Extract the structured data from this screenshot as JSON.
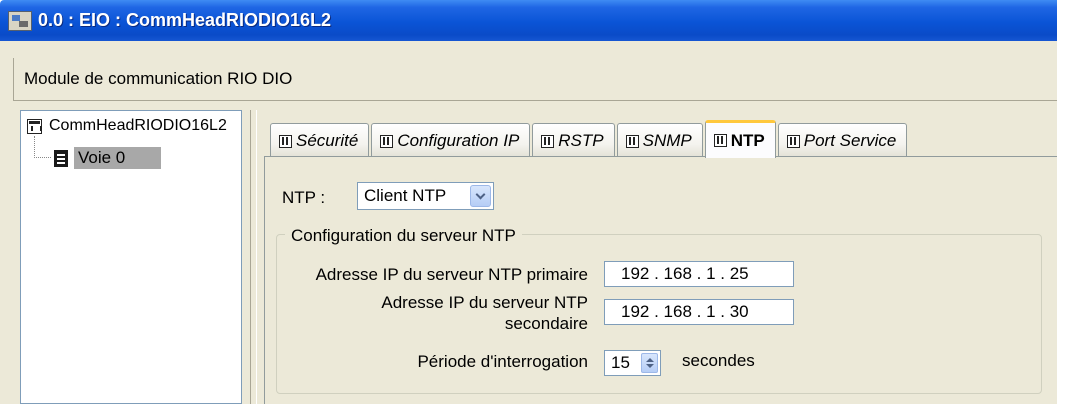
{
  "window": {
    "title": "0.0 : EIO : CommHeadRIODIO16L2",
    "icon": "module-app-icon"
  },
  "header": {
    "title": "Module de communication RIO DIO"
  },
  "tree": {
    "root": {
      "label": "CommHeadRIODIO16L2",
      "icon": "module-icon"
    },
    "children": [
      {
        "label": "Voie 0",
        "icon": "channel-icon",
        "selected": true
      }
    ]
  },
  "tabs": [
    {
      "label": "Sécurité",
      "icon": "module-icon",
      "active": false
    },
    {
      "label": "Configuration IP",
      "icon": "module-icon",
      "active": false
    },
    {
      "label": "RSTP",
      "icon": "module-icon",
      "active": false
    },
    {
      "label": "SNMP",
      "icon": "module-icon",
      "active": false
    },
    {
      "label": "NTP",
      "icon": "module-icon",
      "active": true
    },
    {
      "label": "Port Service",
      "icon": "module-icon",
      "active": false
    }
  ],
  "ntp": {
    "label": "NTP :",
    "mode": "Client NTP",
    "server_group": {
      "title": "Configuration du serveur NTP",
      "primary_label": "Adresse IP du serveur NTP primaire",
      "primary_value": "192 . 168 . 1 . 25",
      "secondary_label_line1": "Adresse IP du serveur NTP",
      "secondary_label_line2": "secondaire",
      "secondary_value": "192 . 168 . 1 . 30",
      "polling_label": "Période d'interrogation",
      "polling_value": "15",
      "polling_unit": "secondes"
    }
  },
  "colors": {
    "titlebar": "#0a54d6",
    "active_tab_accent": "#ffc83c",
    "panel_bg": "#ece9d8"
  }
}
